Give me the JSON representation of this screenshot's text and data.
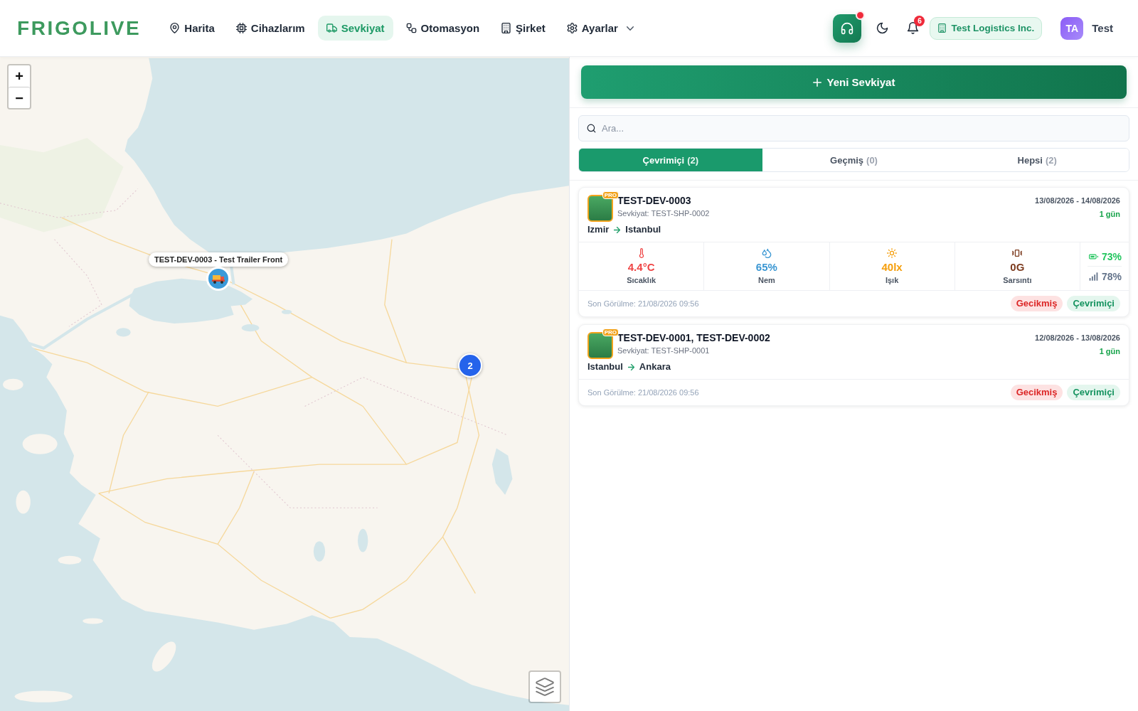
{
  "header": {
    "logo": "FRIGOLIVE",
    "nav": [
      {
        "label": "Harita",
        "kind": "link",
        "selected": false
      },
      {
        "label": "Cihazlarım",
        "kind": "link",
        "selected": false
      },
      {
        "label": "Sevkiyat",
        "kind": "link",
        "selected": true
      },
      {
        "label": "Otomasyon",
        "kind": "link",
        "selected": false
      },
      {
        "label": "Şirket",
        "kind": "link",
        "selected": false
      },
      {
        "label": "Ayarlar",
        "kind": "menu",
        "selected": false
      }
    ],
    "support": {
      "alert": true
    },
    "notifications": {
      "count": "6"
    },
    "company": "Test Logistics Inc.",
    "user": {
      "initials": "TA",
      "name": "Test"
    }
  },
  "map": {
    "zoom_controls": [
      "+",
      "−"
    ],
    "markers": [
      {
        "kind": "device",
        "tooltip": "TEST-DEV-0003 - Test Trailer Front"
      },
      {
        "kind": "cluster",
        "count": "2"
      }
    ]
  },
  "panel": {
    "new_button": "Yeni Sevkiyat",
    "search": {
      "placeholder": "Ara..."
    },
    "tabs": [
      {
        "label": "Çevrimiçi",
        "count": "(2)",
        "selected": true
      },
      {
        "label": "Geçmiş",
        "count": "(0)",
        "selected": false
      },
      {
        "label": "Hepsi",
        "count": "(2)",
        "selected": false
      }
    ],
    "shipments": [
      {
        "badge": "PRO",
        "devices": "TEST-DEV-0003",
        "shipment": "Sevkiyat: TEST-SHP-0002",
        "dates": "13/08/2026 - 14/08/2026",
        "duration": "1 gün",
        "origin": "Izmir",
        "destination": "Istanbul",
        "sensors": [
          {
            "kind": "temperature",
            "value": "4.4°C",
            "label": "Sıcaklık",
            "color": "#ef4444"
          },
          {
            "kind": "humidity",
            "value": "65%",
            "label": "Nem",
            "color": "#3b97d3"
          },
          {
            "kind": "light",
            "value": "40lx",
            "label": "Işık",
            "color": "#f59e0b"
          },
          {
            "kind": "shock",
            "value": "0G",
            "label": "Sarsıntı",
            "color": "#7c3a1d"
          }
        ],
        "battery": "73%",
        "signal": "78%",
        "last_seen": "Son Görülme: 21/08/2026 09:56",
        "tags": [
          {
            "kind": "delayed",
            "label": "Gecikmiş"
          },
          {
            "kind": "online",
            "label": "Çevrimiçi"
          }
        ]
      },
      {
        "badge": "PRO",
        "devices": "TEST-DEV-0001, TEST-DEV-0002",
        "shipment": "Sevkiyat: TEST-SHP-0001",
        "dates": "12/08/2026 - 13/08/2026",
        "duration": "1 gün",
        "origin": "Istanbul",
        "destination": "Ankara",
        "last_seen": "Son Görülme: 21/08/2026 09:56",
        "tags": [
          {
            "kind": "delayed",
            "label": "Gecikmiş"
          },
          {
            "kind": "online",
            "label": "Çevrimiçi"
          }
        ]
      }
    ]
  }
}
